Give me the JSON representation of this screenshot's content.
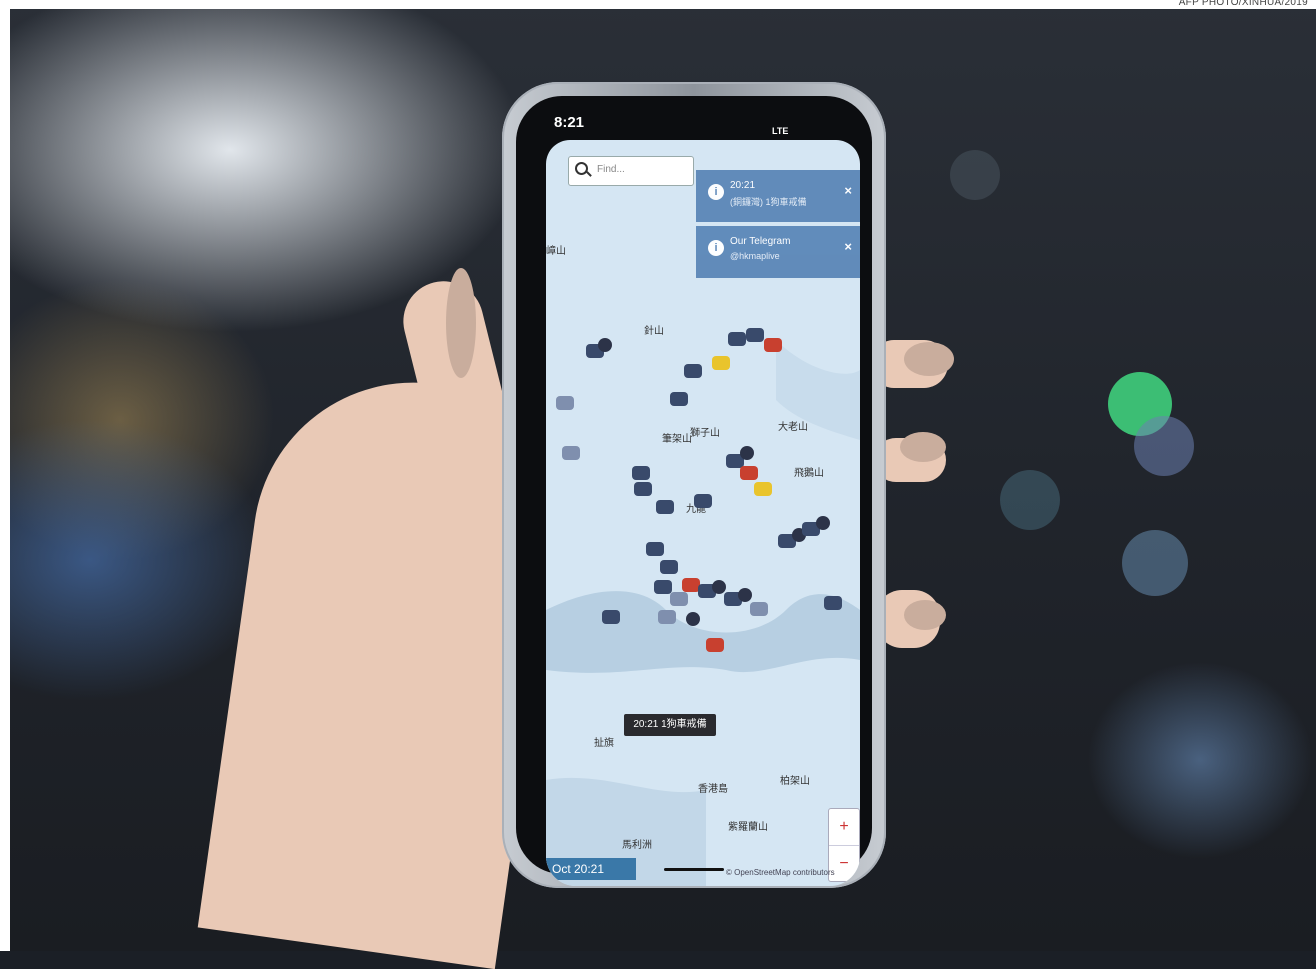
{
  "photo_credit": "AFP PHOTO/XINHUA/2019",
  "phone": {
    "status_time": "8:21",
    "status_network": "LTE",
    "search_placeholder": "Find...",
    "notifications": [
      {
        "line1": "20:21",
        "line2": "(銅鑼灣) 1狗車戒備",
        "close": "×"
      },
      {
        "line1": "Our Telegram",
        "line2": "@hkmaplive",
        "close": "×"
      }
    ],
    "map_labels": [
      "嶂山",
      "針山",
      "獅子山",
      "大老山",
      "筆架山",
      "飛鵝山",
      "九龍",
      "扯旗",
      "香港島",
      "柏架山",
      "紫羅蘭山",
      "馬利洲"
    ],
    "marker_popup": "20:21 1狗車戒備",
    "zoom_in": "+",
    "zoom_out": "−",
    "date_label": "Oct 20:21",
    "attribution": "© OpenStreetMap contributors"
  },
  "icons": [
    "search-icon",
    "info-icon",
    "close-icon",
    "police-van-icon",
    "checkmark-icon",
    "warning-icon",
    "locate-icon"
  ],
  "colors": {
    "map_land": "#d5e6f3",
    "notification_bg": "#5b87b8",
    "marker": "#394a6b",
    "warning": "#e9c42c",
    "alert": "#c8402f"
  }
}
